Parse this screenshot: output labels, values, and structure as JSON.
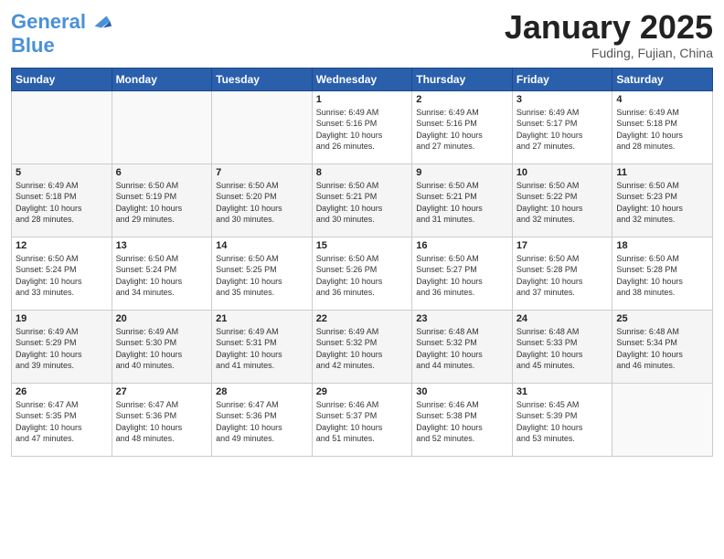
{
  "header": {
    "logo_line1": "General",
    "logo_line2": "Blue",
    "month": "January 2025",
    "location": "Fuding, Fujian, China"
  },
  "weekdays": [
    "Sunday",
    "Monday",
    "Tuesday",
    "Wednesday",
    "Thursday",
    "Friday",
    "Saturday"
  ],
  "weeks": [
    [
      {
        "day": "",
        "info": ""
      },
      {
        "day": "",
        "info": ""
      },
      {
        "day": "",
        "info": ""
      },
      {
        "day": "1",
        "info": "Sunrise: 6:49 AM\nSunset: 5:16 PM\nDaylight: 10 hours\nand 26 minutes."
      },
      {
        "day": "2",
        "info": "Sunrise: 6:49 AM\nSunset: 5:16 PM\nDaylight: 10 hours\nand 27 minutes."
      },
      {
        "day": "3",
        "info": "Sunrise: 6:49 AM\nSunset: 5:17 PM\nDaylight: 10 hours\nand 27 minutes."
      },
      {
        "day": "4",
        "info": "Sunrise: 6:49 AM\nSunset: 5:18 PM\nDaylight: 10 hours\nand 28 minutes."
      }
    ],
    [
      {
        "day": "5",
        "info": "Sunrise: 6:49 AM\nSunset: 5:18 PM\nDaylight: 10 hours\nand 28 minutes."
      },
      {
        "day": "6",
        "info": "Sunrise: 6:50 AM\nSunset: 5:19 PM\nDaylight: 10 hours\nand 29 minutes."
      },
      {
        "day": "7",
        "info": "Sunrise: 6:50 AM\nSunset: 5:20 PM\nDaylight: 10 hours\nand 30 minutes."
      },
      {
        "day": "8",
        "info": "Sunrise: 6:50 AM\nSunset: 5:21 PM\nDaylight: 10 hours\nand 30 minutes."
      },
      {
        "day": "9",
        "info": "Sunrise: 6:50 AM\nSunset: 5:21 PM\nDaylight: 10 hours\nand 31 minutes."
      },
      {
        "day": "10",
        "info": "Sunrise: 6:50 AM\nSunset: 5:22 PM\nDaylight: 10 hours\nand 32 minutes."
      },
      {
        "day": "11",
        "info": "Sunrise: 6:50 AM\nSunset: 5:23 PM\nDaylight: 10 hours\nand 32 minutes."
      }
    ],
    [
      {
        "day": "12",
        "info": "Sunrise: 6:50 AM\nSunset: 5:24 PM\nDaylight: 10 hours\nand 33 minutes."
      },
      {
        "day": "13",
        "info": "Sunrise: 6:50 AM\nSunset: 5:24 PM\nDaylight: 10 hours\nand 34 minutes."
      },
      {
        "day": "14",
        "info": "Sunrise: 6:50 AM\nSunset: 5:25 PM\nDaylight: 10 hours\nand 35 minutes."
      },
      {
        "day": "15",
        "info": "Sunrise: 6:50 AM\nSunset: 5:26 PM\nDaylight: 10 hours\nand 36 minutes."
      },
      {
        "day": "16",
        "info": "Sunrise: 6:50 AM\nSunset: 5:27 PM\nDaylight: 10 hours\nand 36 minutes."
      },
      {
        "day": "17",
        "info": "Sunrise: 6:50 AM\nSunset: 5:28 PM\nDaylight: 10 hours\nand 37 minutes."
      },
      {
        "day": "18",
        "info": "Sunrise: 6:50 AM\nSunset: 5:28 PM\nDaylight: 10 hours\nand 38 minutes."
      }
    ],
    [
      {
        "day": "19",
        "info": "Sunrise: 6:49 AM\nSunset: 5:29 PM\nDaylight: 10 hours\nand 39 minutes."
      },
      {
        "day": "20",
        "info": "Sunrise: 6:49 AM\nSunset: 5:30 PM\nDaylight: 10 hours\nand 40 minutes."
      },
      {
        "day": "21",
        "info": "Sunrise: 6:49 AM\nSunset: 5:31 PM\nDaylight: 10 hours\nand 41 minutes."
      },
      {
        "day": "22",
        "info": "Sunrise: 6:49 AM\nSunset: 5:32 PM\nDaylight: 10 hours\nand 42 minutes."
      },
      {
        "day": "23",
        "info": "Sunrise: 6:48 AM\nSunset: 5:32 PM\nDaylight: 10 hours\nand 44 minutes."
      },
      {
        "day": "24",
        "info": "Sunrise: 6:48 AM\nSunset: 5:33 PM\nDaylight: 10 hours\nand 45 minutes."
      },
      {
        "day": "25",
        "info": "Sunrise: 6:48 AM\nSunset: 5:34 PM\nDaylight: 10 hours\nand 46 minutes."
      }
    ],
    [
      {
        "day": "26",
        "info": "Sunrise: 6:47 AM\nSunset: 5:35 PM\nDaylight: 10 hours\nand 47 minutes."
      },
      {
        "day": "27",
        "info": "Sunrise: 6:47 AM\nSunset: 5:36 PM\nDaylight: 10 hours\nand 48 minutes."
      },
      {
        "day": "28",
        "info": "Sunrise: 6:47 AM\nSunset: 5:36 PM\nDaylight: 10 hours\nand 49 minutes."
      },
      {
        "day": "29",
        "info": "Sunrise: 6:46 AM\nSunset: 5:37 PM\nDaylight: 10 hours\nand 51 minutes."
      },
      {
        "day": "30",
        "info": "Sunrise: 6:46 AM\nSunset: 5:38 PM\nDaylight: 10 hours\nand 52 minutes."
      },
      {
        "day": "31",
        "info": "Sunrise: 6:45 AM\nSunset: 5:39 PM\nDaylight: 10 hours\nand 53 minutes."
      },
      {
        "day": "",
        "info": ""
      }
    ]
  ]
}
